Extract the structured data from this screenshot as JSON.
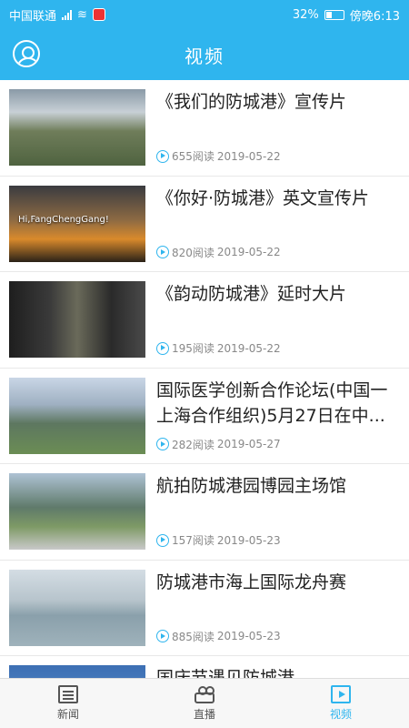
{
  "status_bar": {
    "carrier": "中国联通",
    "network": "⁴⁶",
    "battery": "32%",
    "time": "傍晚6:13"
  },
  "header": {
    "title": "视频"
  },
  "videos": [
    {
      "title": "《我们的防城港》宣传片",
      "views": "655阅读",
      "date": "2019-05-22"
    },
    {
      "title": "《你好·防城港》英文宣传片",
      "views": "820阅读",
      "date": "2019-05-22",
      "thumb_text": "Hi,FangChengGang!"
    },
    {
      "title": "《韵动防城港》延时大片",
      "views": "195阅读",
      "date": "2019-05-22"
    },
    {
      "title": "国际医学创新合作论坛(中国一上海合作组织)5月27日在中...",
      "views": "282阅读",
      "date": "2019-05-27"
    },
    {
      "title": "航拍防城港园博园主场馆",
      "views": "157阅读",
      "date": "2019-05-23"
    },
    {
      "title": "防城港市海上国际龙舟赛",
      "views": "885阅读",
      "date": "2019-05-23"
    },
    {
      "title": "国庆节遇见防城港",
      "views": "",
      "date": ""
    }
  ],
  "tabs": [
    {
      "label": "新闻",
      "icon": "news-icon"
    },
    {
      "label": "直播",
      "icon": "live-icon"
    },
    {
      "label": "视频",
      "icon": "video-icon",
      "active": true
    }
  ],
  "colors": {
    "accent": "#2fb5ee"
  }
}
